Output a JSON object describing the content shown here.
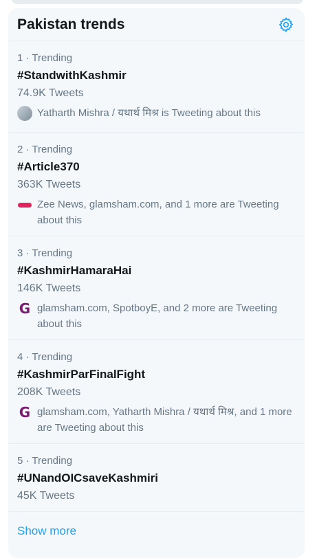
{
  "panel": {
    "title": "Pakistan trends",
    "settings_icon": "gear-icon",
    "accent": "#1da1f2"
  },
  "trends": [
    {
      "meta": "1 · Trending",
      "tag": "#StandwithKashmir",
      "count": "74.9K Tweets",
      "context": "Yatharth Mishra / यथार्थ मिश्र is Tweeting about this",
      "icon": "avatar-icon"
    },
    {
      "meta": "2 · Trending",
      "tag": "#Article370",
      "count": "363K Tweets",
      "context": "Zee News, glamsham.com, and 1 more are Tweeting about this",
      "icon": "zee-news-logo-icon"
    },
    {
      "meta": "3 · Trending",
      "tag": "#KashmirHamaraHai",
      "count": "146K Tweets",
      "context": "glamsham.com, SpotboyE, and 2 more are Tweeting about this",
      "icon": "glamsham-logo-icon"
    },
    {
      "meta": "4 · Trending",
      "tag": "#KashmirParFinalFight",
      "count": "208K Tweets",
      "context": "glamsham.com, Yatharth Mishra / यथार्थ मिश्र, and 1 more are Tweeting about this",
      "icon": "glamsham-logo-icon"
    },
    {
      "meta": "5 · Trending",
      "tag": "#UNandOICsaveKashmiri",
      "count": "45K Tweets",
      "context": "",
      "icon": ""
    }
  ],
  "show_more": "Show more"
}
